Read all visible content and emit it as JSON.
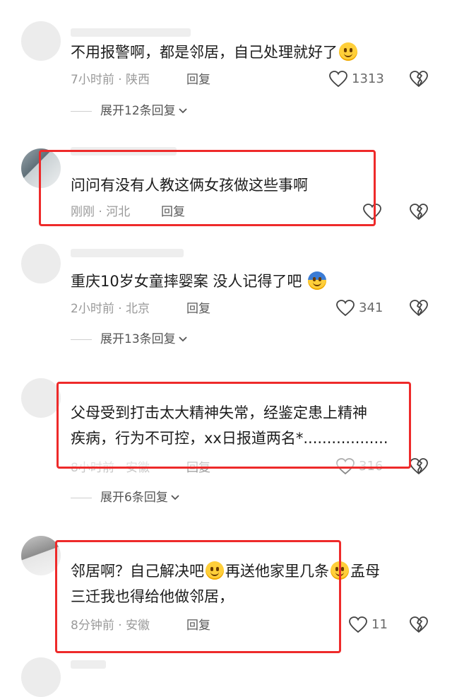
{
  "comments": [
    {
      "text": "不用报警啊，都是邻居，自己处理就好了",
      "time": "7小时前",
      "location": "陕西",
      "reply_label": "回复",
      "likes": "1313",
      "expand_label": "展开12条回复"
    },
    {
      "text": "问问有没有人教这俩女孩做这些事啊",
      "time": "刚刚",
      "location": "河北",
      "reply_label": "回复",
      "likes": ""
    },
    {
      "text": "重庆10岁女童摔婴案 没人记得了吧",
      "time": "2小时前",
      "location": "北京",
      "reply_label": "回复",
      "likes": "341",
      "expand_label": "展开13条回复"
    },
    {
      "text_line1": "父母受到打击太大精神失常，经鉴定患上精神",
      "text_line2": "疾病，行为不可控，xx日报道两名*..................",
      "time": "8小时前",
      "location": "安徽",
      "reply_label": "回复",
      "likes": "316",
      "expand_label": "展开6条回复"
    },
    {
      "text_part1": "邻居啊？自己解决吧",
      "text_part2": "再送他家里几条",
      "text_part3": "孟母",
      "text_line2": "三迁我也得给他做邻居，",
      "time": "8分钟前",
      "location": "安徽",
      "reply_label": "回复",
      "likes": "11"
    }
  ],
  "separator": "·",
  "icons": {
    "like": "heart-outline-icon",
    "dislike": "broken-heart-icon",
    "expand": "chevron-down-icon",
    "emoji_smile": "smile-emoji-icon",
    "emoji_cold": "cold-face-emoji-icon"
  },
  "colors": {
    "highlight_box": "#ee2a2a",
    "meta_text": "#9a9a9a"
  }
}
